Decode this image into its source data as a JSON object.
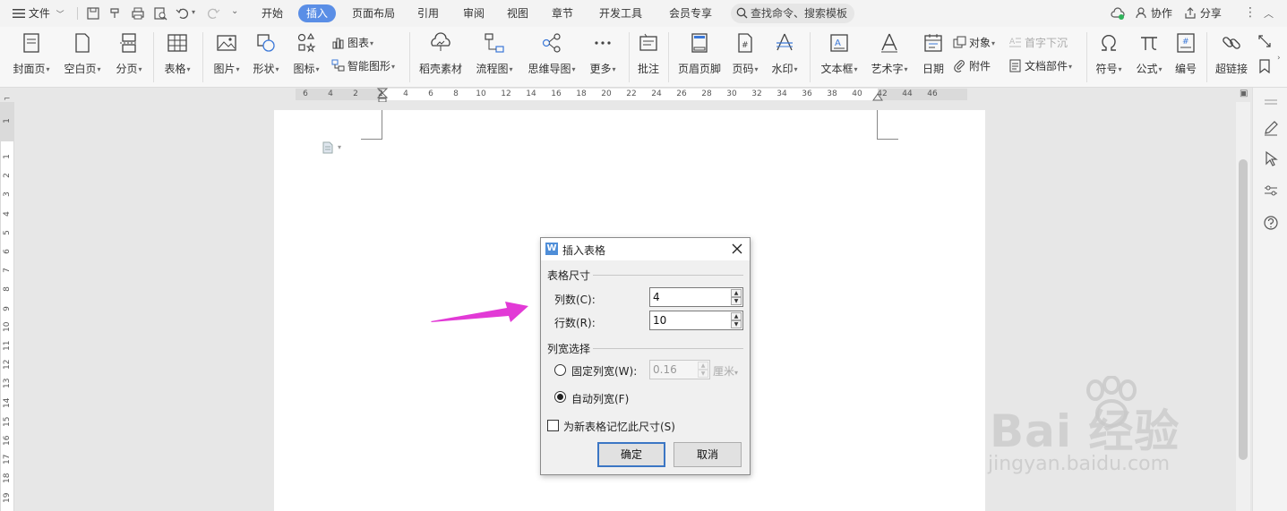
{
  "tabbar": {
    "file_label": "文件",
    "tabs": [
      {
        "label": "开始",
        "active": false
      },
      {
        "label": "插入",
        "active": true
      },
      {
        "label": "页面布局",
        "active": false
      },
      {
        "label": "引用",
        "active": false
      },
      {
        "label": "审阅",
        "active": false
      },
      {
        "label": "视图",
        "active": false
      },
      {
        "label": "章节",
        "active": false
      },
      {
        "label": "开发工具",
        "active": false
      },
      {
        "label": "会员专享",
        "active": false
      }
    ],
    "search_placeholder": "查找命令、搜索模板",
    "collab_label": "协作",
    "share_label": "分享"
  },
  "ribbon": {
    "cover_page": "封面页",
    "blank_page": "空白页",
    "page_break": "分页",
    "table": "表格",
    "picture": "图片",
    "shape": "形状",
    "icon": "图标",
    "chart": "图表",
    "smart_art": "智能图形",
    "docer_material": "稻壳素材",
    "flowchart": "流程图",
    "mind_map": "思维导图",
    "more": "更多",
    "comment": "批注",
    "header_footer": "页眉页脚",
    "page_number": "页码",
    "watermark": "水印",
    "text_box": "文本框",
    "word_art": "艺术字",
    "date": "日期",
    "object": "对象",
    "attachment": "附件",
    "drop_cap": "首字下沉",
    "doc_parts": "文档部件",
    "symbol": "符号",
    "formula": "公式",
    "numbering": "编号",
    "hyperlink": "超链接"
  },
  "ruler": {
    "h_numbers": [
      "6",
      "4",
      "2",
      "2",
      "4",
      "6",
      "8",
      "10",
      "12",
      "14",
      "16",
      "18",
      "20",
      "22",
      "24",
      "26",
      "28",
      "30",
      "32",
      "34",
      "36",
      "38",
      "40",
      "42",
      "44",
      "46"
    ],
    "v_numbers": [
      "1",
      "1",
      "2",
      "3",
      "4",
      "5",
      "6",
      "7",
      "8",
      "9",
      "10",
      "11",
      "12",
      "13",
      "14",
      "15",
      "16",
      "17",
      "18",
      "19"
    ]
  },
  "dialog": {
    "title": "插入表格",
    "size_group": "表格尺寸",
    "columns_label": "列数(C):",
    "columns_value": "4",
    "rows_label": "行数(R):",
    "rows_value": "10",
    "width_group": "列宽选择",
    "fixed_width_label": "固定列宽(W):",
    "fixed_width_value": "0.16",
    "fixed_width_unit": "厘米",
    "auto_width_label": "自动列宽(F)",
    "remember_label": "为新表格记忆此尺寸(S)",
    "ok_label": "确定",
    "cancel_label": "取消",
    "auto_width_selected": true,
    "remember_checked": false
  },
  "watermark": {
    "main": "Bai 经验",
    "sub": "jingyan.baidu.com"
  },
  "colors": {
    "active_tab": "#5a8ee6",
    "arrow": "#e23ad6",
    "dialog_logo": "#4f8ed8"
  }
}
